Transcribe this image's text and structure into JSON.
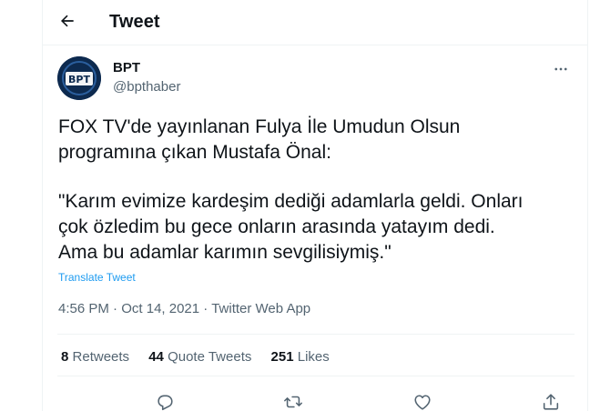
{
  "header": {
    "title": "Tweet",
    "back_icon": "arrow-left-icon"
  },
  "author": {
    "name": "BPT",
    "handle": "@bpthaber",
    "avatar_text": "BPT",
    "avatar_color": "#0d2a4f"
  },
  "tweet": {
    "paragraph1": "FOX TV'de yayınlanan Fulya İle Umudun Olsun\nprogramına çıkan Mustafa Önal:",
    "paragraph2": "\"Karım evimize kardeşim dediği adamlarla geldi. Onları\nçok özledim bu gece onların arasında yatayım dedi.\nAma bu adamlar karımın sevgilisiymiş.\"",
    "translate_label": "Translate Tweet",
    "time": "4:56 PM",
    "date": "Oct 14, 2021",
    "separator": "·",
    "source": "Twitter Web App"
  },
  "stats": {
    "retweets_count": "8",
    "retweets_label": "Retweets",
    "quotes_count": "44",
    "quotes_label": "Quote Tweets",
    "likes_count": "251",
    "likes_label": "Likes"
  },
  "actions": [
    "reply-icon",
    "retweet-icon",
    "like-icon",
    "share-icon"
  ],
  "colors": {
    "link": "#1d9bf0",
    "secondary_text": "#536471",
    "divider": "#eff3f4"
  }
}
